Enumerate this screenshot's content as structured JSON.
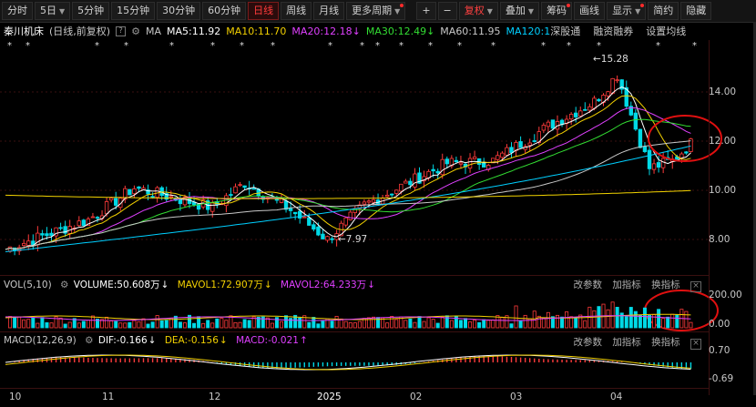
{
  "toolbar": {
    "left": [
      {
        "label": "分时",
        "active": false
      },
      {
        "label": "5日",
        "active": false,
        "caret": true
      },
      {
        "label": "5分钟",
        "active": false
      },
      {
        "label": "15分钟",
        "active": false
      },
      {
        "label": "30分钟",
        "active": false
      },
      {
        "label": "60分钟",
        "active": false
      },
      {
        "label": "日线",
        "active": true
      },
      {
        "label": "周线",
        "active": false
      },
      {
        "label": "月线",
        "active": false
      },
      {
        "label": "更多周期",
        "active": false,
        "caret": true,
        "dot": true
      }
    ],
    "right": [
      {
        "label": "+"
      },
      {
        "label": "−"
      },
      {
        "label": "复权",
        "accent": true,
        "caret": true
      },
      {
        "label": "叠加",
        "caret": true
      },
      {
        "label": "筹码",
        "dot": true
      },
      {
        "label": "画线"
      },
      {
        "label": "显示",
        "caret": true,
        "dot": true
      },
      {
        "label": "简约"
      },
      {
        "label": "隐藏"
      }
    ]
  },
  "info": {
    "title": "秦川机床",
    "mode": "(日线,前复权)",
    "ma_label": "MA",
    "ma5": "MA5:11.92",
    "ma10": "MA10:11.70",
    "ma20": "MA20:12.18",
    "ma30": "MA30:12.49",
    "ma60": "MA60:11.95",
    "ma120": "MA120:1",
    "links": [
      "深股通",
      "融资融券",
      "设置均线"
    ]
  },
  "colors": {
    "up": "#ff3b3b",
    "down": "#00d9e6",
    "ma5": "#ffffff",
    "ma10": "#f2d000",
    "ma20": "#e040ff",
    "ma30": "#33dd33",
    "ma60": "#c8c8c8",
    "ma120": "#00cfff",
    "ma250": "#f2d200"
  },
  "main": {
    "high_label": "←15.28",
    "low_label": "←7.97",
    "y_ticks": [
      "14.00",
      "12.00",
      "10.00",
      "8.00"
    ]
  },
  "volume": {
    "title": "VOL(5,10)",
    "volume": "VOLUME:50.608万",
    "mavol1": "MAVOL1:72.907万",
    "mavol2": "MAVOL2:64.233万",
    "buttons": [
      "改参数",
      "加指标",
      "换指标"
    ],
    "y_ticks": [
      "200.00",
      "0.00"
    ]
  },
  "macd": {
    "title": "MACD(12,26,9)",
    "dif": "DIF:-0.166",
    "dea": "DEA:-0.156",
    "macd": "MACD:-0.021",
    "buttons": [
      "改参数",
      "加指标",
      "换指标"
    ],
    "y_ticks": [
      "0.70",
      "-0.69"
    ]
  },
  "x_labels": [
    "10",
    "11",
    "12",
    "2025",
    "02",
    "03",
    "04"
  ]
}
